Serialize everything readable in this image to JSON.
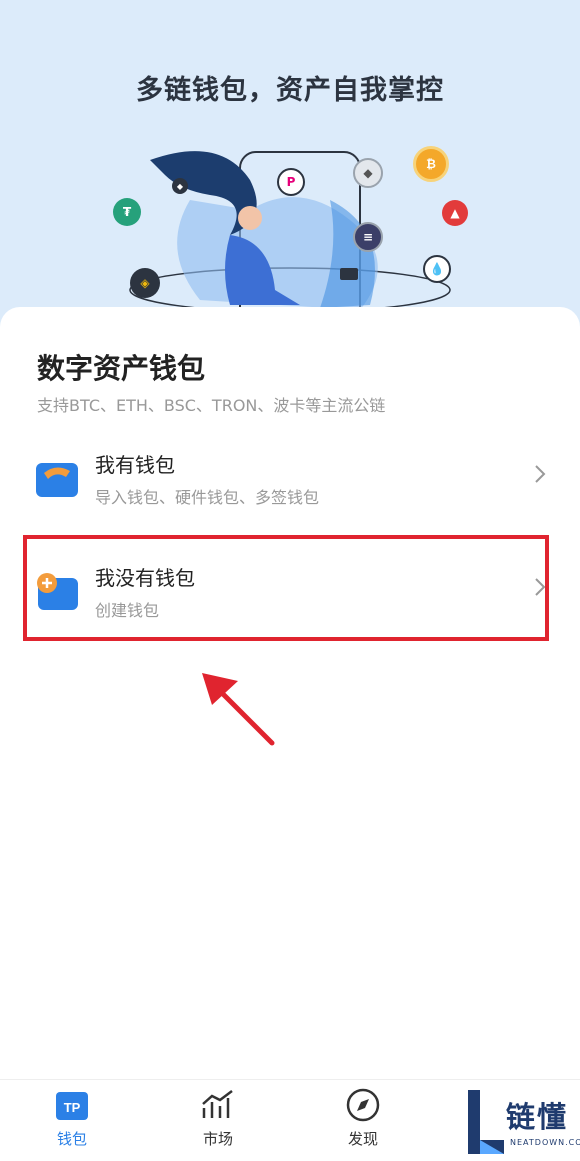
{
  "hero": {
    "title": "多链钱包，资产自我掌控",
    "coin_icons": [
      "bitcoin-icon",
      "ethereum-icon",
      "polkadot-icon",
      "solana-icon",
      "tron-icon",
      "filecoin-icon",
      "tether-icon",
      "binance-icon",
      "eos-icon"
    ]
  },
  "card": {
    "title": "数字资产钱包",
    "subtitle": "支持BTC、ETH、BSC、TRON、波卡等主流公链",
    "options": [
      {
        "label": "我有钱包",
        "desc": "导入钱包、硬件钱包、多签钱包",
        "icon": "import-wallet-icon"
      },
      {
        "label": "我没有钱包",
        "desc": "创建钱包",
        "icon": "create-wallet-icon"
      }
    ]
  },
  "tabbar": {
    "items": [
      {
        "label": "钱包",
        "icon": "tp-wallet-icon",
        "active": true
      },
      {
        "label": "市场",
        "icon": "market-chart-icon",
        "active": false
      },
      {
        "label": "发现",
        "icon": "compass-icon",
        "active": false
      }
    ]
  },
  "watermark": {
    "brand": "链懂",
    "url": "NEATDOWN.COM"
  },
  "colors": {
    "accent": "#2b80e6",
    "highlight": "#e0242f",
    "hero_bg": "#dcebfa"
  }
}
